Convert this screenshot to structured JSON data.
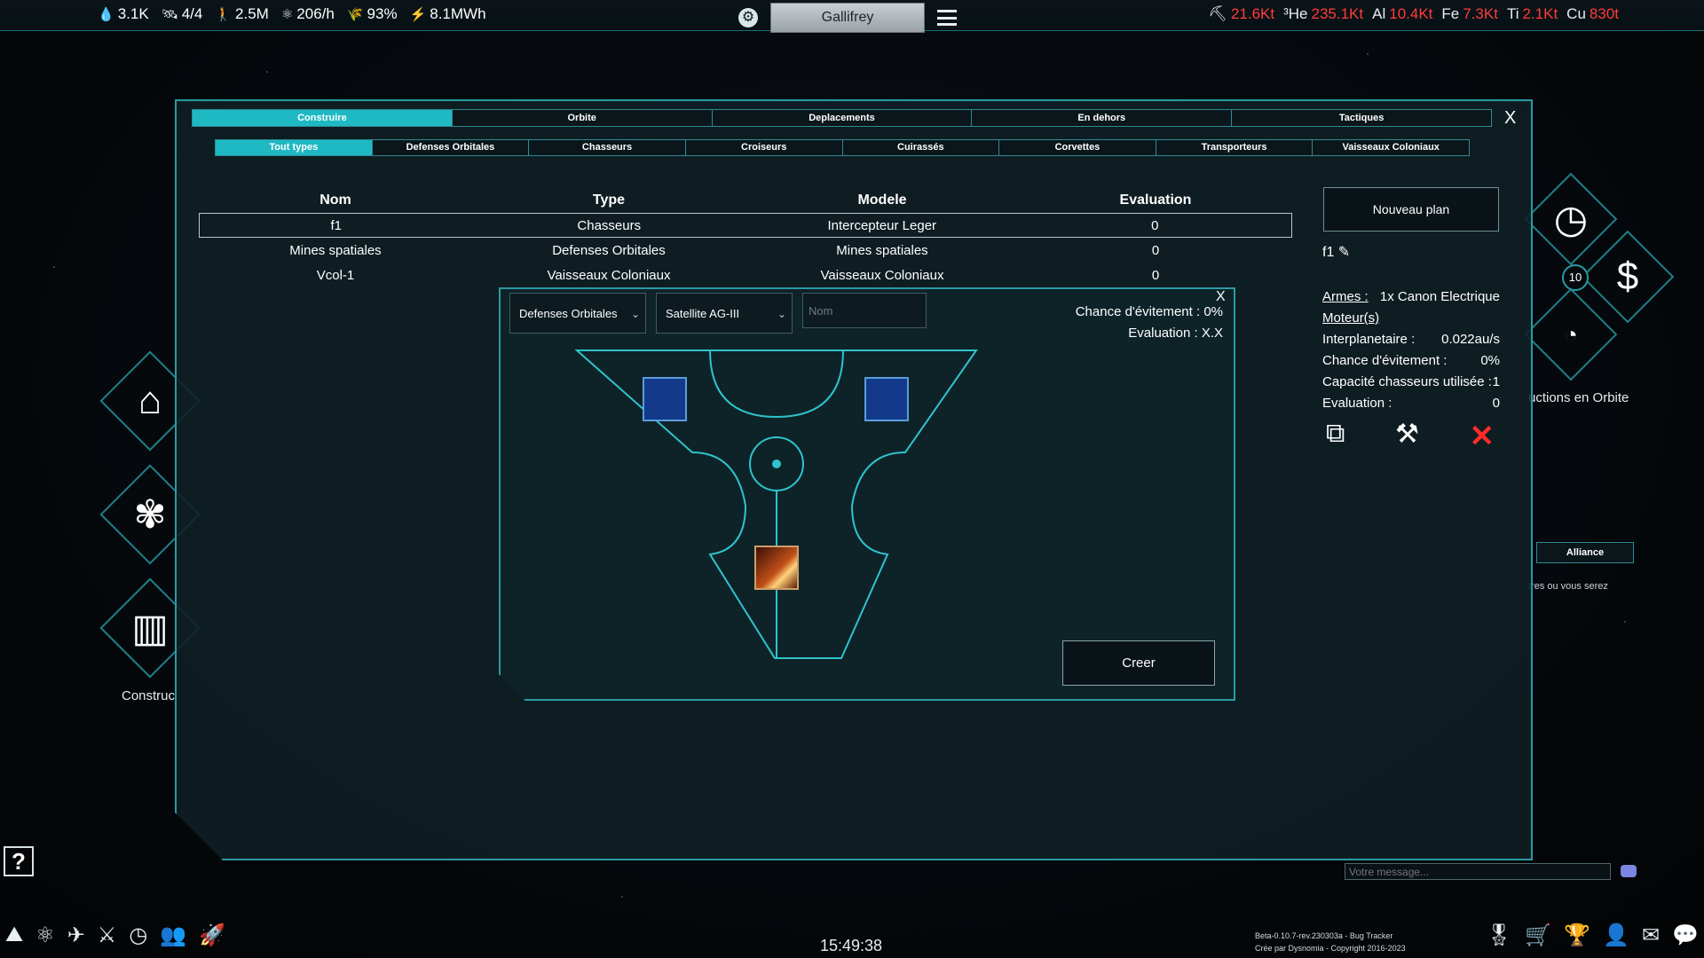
{
  "topbar": {
    "resources_left": [
      {
        "icon": "water-drop-icon",
        "glyph": "💧",
        "value": "3.1K"
      },
      {
        "icon": "satellite-icon",
        "glyph": "🛰",
        "value": "4/4"
      },
      {
        "icon": "population-icon",
        "glyph": "🚶",
        "value": "2.5M"
      },
      {
        "icon": "atom-icon",
        "glyph": "⚛",
        "value": "206/h"
      },
      {
        "icon": "food-icon",
        "glyph": "🌾",
        "value": "93%"
      },
      {
        "icon": "energy-icon",
        "glyph": "⚡",
        "value": "8.1MWh"
      }
    ],
    "planet_name": "Gallifrey",
    "resources_right": [
      {
        "key": "⛏",
        "value": "21.6Kt"
      },
      {
        "key": "³He",
        "value": "235.1Kt"
      },
      {
        "key": "Al",
        "value": "10.4Kt"
      },
      {
        "key": "Fe",
        "value": "7.3Kt"
      },
      {
        "key": "Ti",
        "value": "2.1Kt"
      },
      {
        "key": "Cu",
        "value": "830t"
      }
    ]
  },
  "panel": {
    "close": "X",
    "main_tabs": [
      "Construire",
      "Orbite",
      "Deplacements",
      "En dehors",
      "Tactiques"
    ],
    "active_main_tab": 0,
    "sub_tabs": [
      "Tout types",
      "Defenses Orbitales",
      "Chasseurs",
      "Croiseurs",
      "Cuirassés",
      "Corvettes",
      "Transporteurs",
      "Vaisseaux Coloniaux"
    ],
    "active_sub_tab": 0,
    "table": {
      "headers": [
        "Nom",
        "Type",
        "Modele",
        "Evaluation"
      ],
      "rows": [
        [
          "f1",
          "Chasseurs",
          "Intercepteur Leger",
          "0"
        ],
        [
          "Mines spatiales",
          "Defenses Orbitales",
          "Mines spatiales",
          "0"
        ],
        [
          "Vcol-1",
          "Vaisseaux Coloniaux",
          "Vaisseaux Coloniaux",
          "0"
        ]
      ]
    }
  },
  "designer": {
    "close": "X",
    "type_select": "Defenses Orbitales",
    "model_select": "Satellite AG-III",
    "name_placeholder": "Nom",
    "dodge_chance": "Chance d'évitement : 0%",
    "evaluation": "Evaluation : X.X",
    "create_label": "Creer"
  },
  "right_panel": {
    "new_plan": "Nouveau plan",
    "plan_name": "f1",
    "weapons_label": "Armes :",
    "weapons_value": "1x Canon Electrique",
    "engines_label": "Moteur(s)",
    "stats": [
      {
        "label": "Interplanetaire :",
        "value": "0.022au/s"
      },
      {
        "label": "Chance d'évitement :",
        "value": "0%"
      },
      {
        "label": "Capacité chasseurs utilisée :",
        "value": "1"
      },
      {
        "label": "Evaluation :",
        "value": "0"
      }
    ],
    "badge": "10",
    "orbit_label": "uctions en Orbite",
    "alliance_tab": "Alliance",
    "alliance_text": "tres ou vous serez"
  },
  "left_panel": {
    "label": "Construc"
  },
  "chat": {
    "placeholder": "Votre message..."
  },
  "bottom": {
    "clock": "15:49:38",
    "version_line1": "Beta-0.10.7-rev.230303a - Bug Tracker",
    "version_line2": "Crée par Dysnomia - Copyright 2016-2023"
  },
  "colors": {
    "accent": "#1fb9c4",
    "border": "#2a9aa4",
    "alert": "#ff3b3b"
  }
}
